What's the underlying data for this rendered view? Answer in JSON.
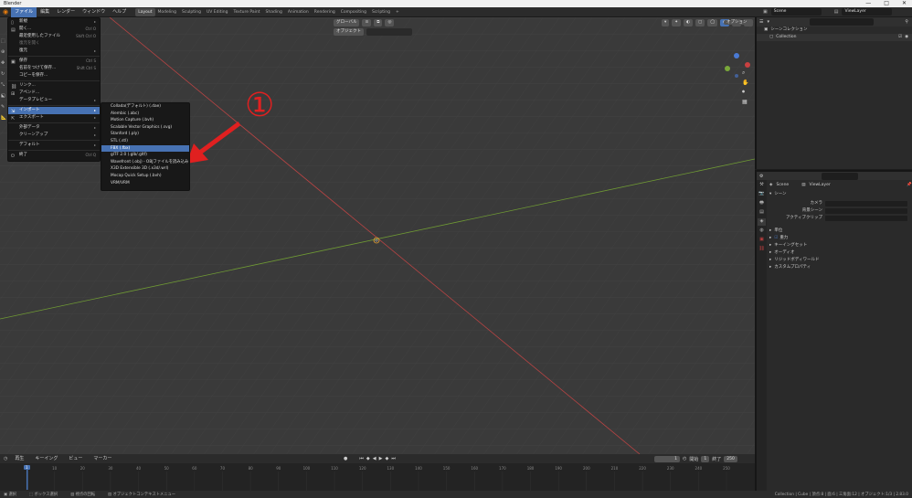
{
  "app": {
    "title": "Blender",
    "window_controls": [
      "—",
      "□",
      "✕"
    ]
  },
  "menubar": {
    "items": [
      "ファイル",
      "編集",
      "レンダー",
      "ウィンドウ",
      "ヘルプ"
    ],
    "workspaces": [
      "Layout",
      "Modeling",
      "Sculpting",
      "UV Editing",
      "Texture Paint",
      "Shading",
      "Animation",
      "Rendering",
      "Compositing",
      "Scripting",
      "+"
    ],
    "scene_label": "Scene",
    "view_layer_label": "ViewLayer"
  },
  "viewport": {
    "mode": "オブジェクト",
    "transform": "グローバル",
    "options": "オプション",
    "annotation_number": "①"
  },
  "file_menu": {
    "items": [
      {
        "label": "新規",
        "shortcut": "",
        "kind": "submenu"
      },
      {
        "label": "開く...",
        "shortcut": "Ctrl O",
        "kind": "item"
      },
      {
        "label": "最近使用したファイル",
        "shortcut": "Shift Ctrl O",
        "kind": "submenu"
      },
      {
        "label": "復元を開く",
        "shortcut": "",
        "kind": "dim"
      },
      {
        "label": "復元",
        "shortcut": "",
        "kind": "submenu"
      },
      {
        "label": "保存",
        "shortcut": "Ctrl S",
        "kind": "item"
      },
      {
        "label": "名前をつけて保存...",
        "shortcut": "Shift Ctrl S",
        "kind": "item"
      },
      {
        "label": "コピーを保存...",
        "shortcut": "",
        "kind": "item"
      },
      {
        "label": "リンク...",
        "shortcut": "",
        "kind": "item"
      },
      {
        "label": "アペンド...",
        "shortcut": "",
        "kind": "item"
      },
      {
        "label": "データプレビュー",
        "shortcut": "",
        "kind": "submenu"
      },
      {
        "label": "インポート",
        "shortcut": "",
        "kind": "highlight"
      },
      {
        "label": "エクスポート",
        "shortcut": "",
        "kind": "submenu"
      },
      {
        "label": "外部データ",
        "shortcut": "",
        "kind": "submenu"
      },
      {
        "label": "クリーンアップ",
        "shortcut": "",
        "kind": "submenu"
      },
      {
        "label": "デフォルト",
        "shortcut": "",
        "kind": "submenu"
      },
      {
        "label": "終了",
        "shortcut": "Ctrl Q",
        "kind": "item"
      }
    ]
  },
  "import_menu": {
    "items": [
      "Collada(デフォルト) (.dae)",
      "Alembic (.abc)",
      "Motion Capture (.bvh)",
      "Scalable Vector Graphics (.svg)",
      "Stanford (.ply)",
      "STL (.stl)",
      "FBX (.fbx)",
      "glTF 2.0 (.glb/.gltf)",
      "Wavefront (.obj) - OBJファイルを読み込みます",
      "X3D Extensible 3D (.x3d/.wrl)",
      "Mocap Quick Setup (.bvh)",
      "VRM/VRM"
    ],
    "highlight_index": 6
  },
  "outliner": {
    "search_placeholder": "",
    "items": [
      "シーンコレクション",
      "Collection"
    ]
  },
  "properties": {
    "scene_name": "Scene",
    "view_layer": "ViewLayer",
    "section": "シーン",
    "rows": [
      {
        "label": "カメラ",
        "value": ""
      },
      {
        "label": "背景シーン",
        "value": ""
      },
      {
        "label": "アクティブクリップ",
        "value": ""
      }
    ],
    "panels": [
      "単位",
      "重力",
      "キーイングセット",
      "オーディオ",
      "リジッドボディワールド",
      "カスタムプロパティ"
    ]
  },
  "timeline": {
    "menus": [
      "再生",
      "キーイング",
      "ビュー",
      "マーカー"
    ],
    "current_frame": "1",
    "start_label": "開始",
    "start": "1",
    "end_label": "終了",
    "end": "250",
    "ruler": [
      "0",
      "10",
      "20",
      "30",
      "40",
      "50",
      "60",
      "70",
      "80",
      "90",
      "100",
      "110",
      "120",
      "130",
      "140",
      "150",
      "160",
      "170",
      "180",
      "190",
      "200",
      "210",
      "220",
      "230",
      "240",
      "250"
    ]
  },
  "statusbar": {
    "items": [
      "選択",
      "ボックス選択",
      "視点の回転",
      "オブジェクトコンテキストメニュー"
    ],
    "right": "Collection | Cube | 頂点:8 | 面:6 | 三角面:12 | オブジェクト:1/3 | 2.83.0"
  },
  "colors": {
    "accent": "#4772b3",
    "x_axis": "#c84040",
    "y_axis": "#7aa83a",
    "arrow": "#e02020"
  }
}
